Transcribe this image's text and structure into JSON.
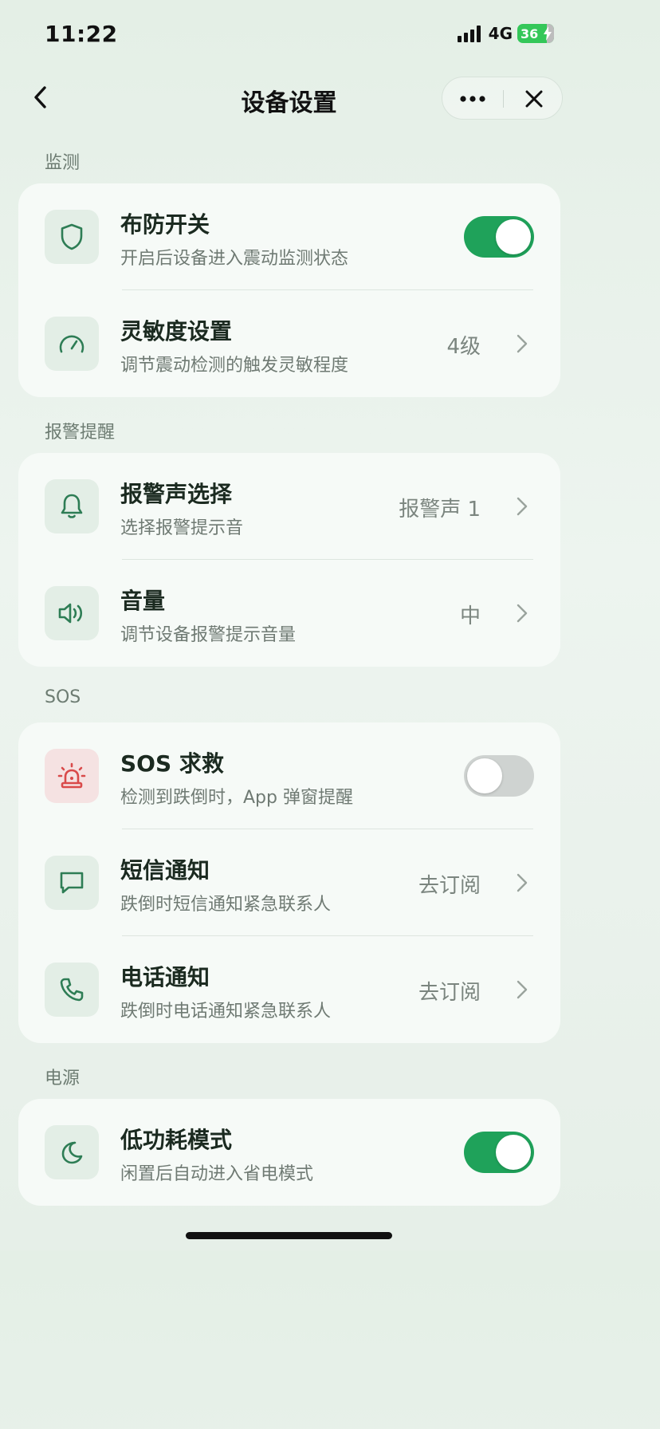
{
  "status_bar": {
    "time": "11:22",
    "network": "4G",
    "battery": "36"
  },
  "nav": {
    "title": "设备设置",
    "back_icon": "chevron-left-icon",
    "more_icon": "more-dots-icon",
    "close_icon": "close-icon"
  },
  "sections": [
    {
      "label": "监测",
      "rows": [
        {
          "title": "布防开关",
          "subtitle": "开启后设备进入震动监测状态",
          "icon": "shield-icon",
          "toggle": true
        },
        {
          "title": "灵敏度设置",
          "subtitle": "调节震动检测的触发灵敏程度",
          "icon": "gauge-icon",
          "value": "4级"
        }
      ]
    },
    {
      "label": "报警提醒",
      "rows": [
        {
          "title": "报警声选择",
          "subtitle": "选择报警提示音",
          "icon": "bell-icon",
          "value": "报警声 1"
        },
        {
          "title": "音量",
          "subtitle": "调节设备报警提示音量",
          "icon": "speaker-icon",
          "value": "中"
        }
      ]
    },
    {
      "label": "SOS",
      "rows": [
        {
          "title": "SOS 求救",
          "subtitle": "检测到跌倒时，App 弹窗提醒",
          "icon": "siren-icon",
          "toggle": false
        },
        {
          "title": "短信通知",
          "subtitle": "跌倒时短信通知紧急联系人",
          "icon": "message-icon",
          "value": "去订阅"
        },
        {
          "title": "电话通知",
          "subtitle": "跌倒时电话通知紧急联系人",
          "icon": "phone-icon",
          "value": "去订阅"
        }
      ]
    },
    {
      "label": "电源",
      "rows": [
        {
          "title": "低功耗模式",
          "subtitle": "闲置后自动进入省电模式",
          "icon": "moon-icon",
          "toggle": true
        }
      ]
    }
  ],
  "colors": {
    "accent": "#1fa25a",
    "icon_green": "#2e7d55",
    "alert_red": "#d94a4a",
    "toggle_off": "#cfd3d1",
    "battery": "#34c759"
  }
}
